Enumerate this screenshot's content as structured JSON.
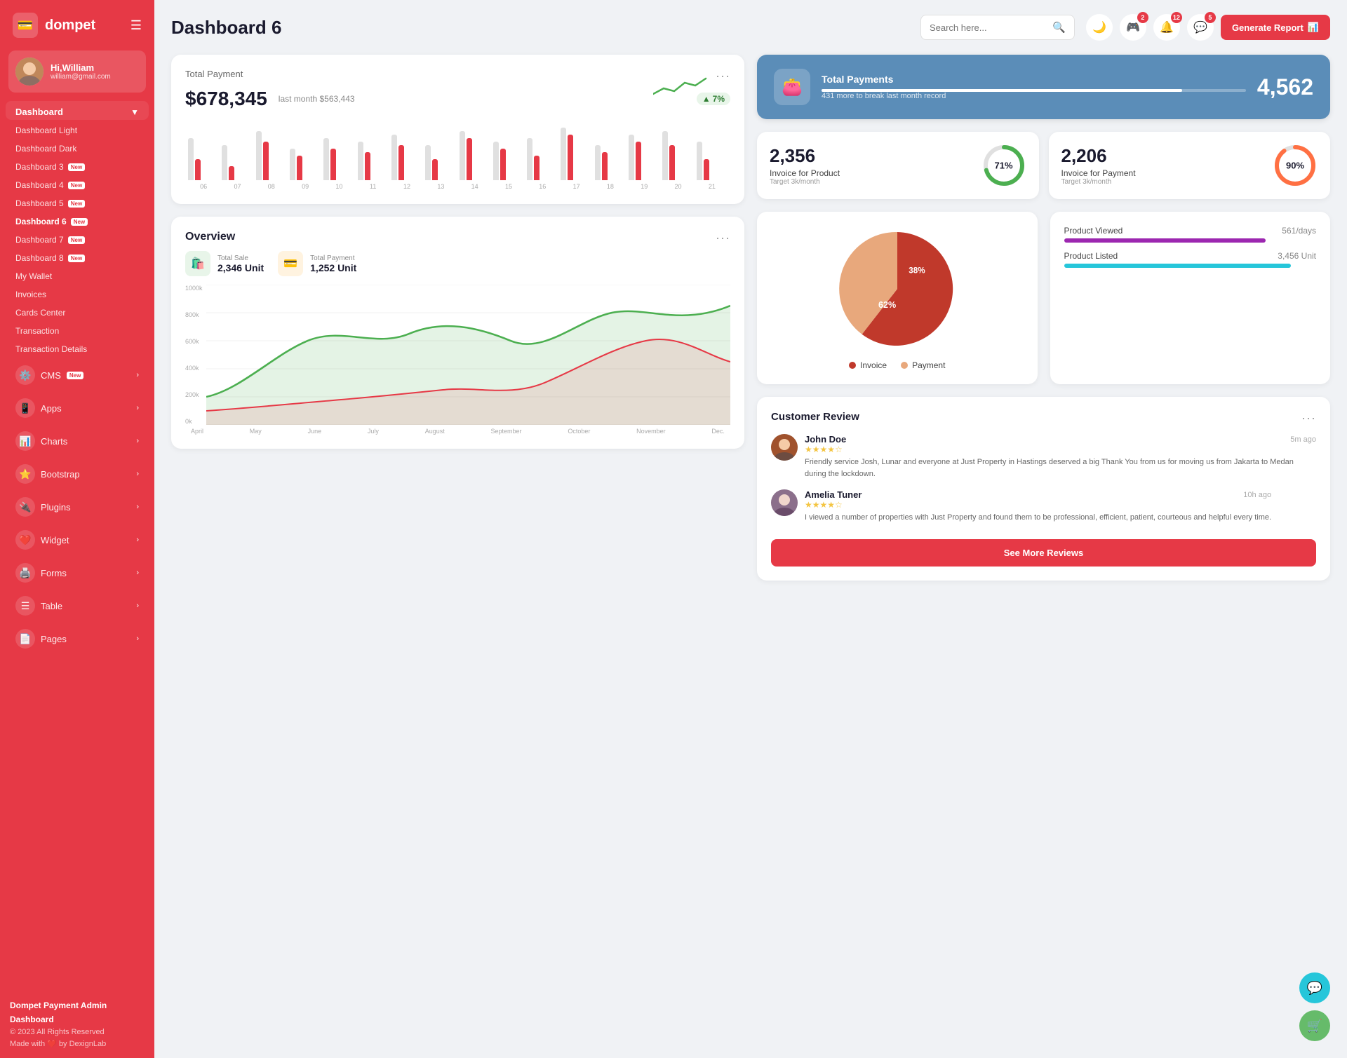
{
  "app": {
    "name": "dompet",
    "logo_icon": "💳"
  },
  "sidebar": {
    "user": {
      "greeting": "Hi,William",
      "email": "william@gmail.com"
    },
    "dashboard_section": "Dashboard",
    "dashboard_items": [
      {
        "label": "Dashboard Light",
        "new": false
      },
      {
        "label": "Dashboard Dark",
        "new": false
      },
      {
        "label": "Dashboard 3",
        "new": true
      },
      {
        "label": "Dashboard 4",
        "new": true
      },
      {
        "label": "Dashboard 5",
        "new": true
      },
      {
        "label": "Dashboard 6",
        "new": true,
        "active": true
      },
      {
        "label": "Dashboard 7",
        "new": true
      },
      {
        "label": "Dashboard 8",
        "new": true
      },
      {
        "label": "My Wallet",
        "new": false
      },
      {
        "label": "Invoices",
        "new": false
      },
      {
        "label": "Cards Center",
        "new": false
      },
      {
        "label": "Transaction",
        "new": false
      },
      {
        "label": "Transaction Details",
        "new": false
      }
    ],
    "nav_items": [
      {
        "label": "CMS",
        "icon": "⚙️",
        "new": true,
        "has_arrow": true
      },
      {
        "label": "Apps",
        "icon": "📱",
        "new": false,
        "has_arrow": true
      },
      {
        "label": "Charts",
        "icon": "📊",
        "new": false,
        "has_arrow": true
      },
      {
        "label": "Bootstrap",
        "icon": "⭐",
        "new": false,
        "has_arrow": true
      },
      {
        "label": "Plugins",
        "icon": "🔌",
        "new": false,
        "has_arrow": true
      },
      {
        "label": "Widget",
        "icon": "❤️",
        "new": false,
        "has_arrow": true
      },
      {
        "label": "Forms",
        "icon": "🖨️",
        "new": false,
        "has_arrow": true
      },
      {
        "label": "Table",
        "icon": "☰",
        "new": false,
        "has_arrow": true
      },
      {
        "label": "Pages",
        "icon": "📄",
        "new": false,
        "has_arrow": true
      }
    ],
    "footer": {
      "brand": "Dompet Payment Admin Dashboard",
      "copy": "© 2023 All Rights Reserved",
      "made_with": "Made with ❤️ by DexignLab"
    }
  },
  "header": {
    "title": "Dashboard 6",
    "search_placeholder": "Search here...",
    "notifications": [
      {
        "icon": "🎮",
        "count": 2
      },
      {
        "icon": "🔔",
        "count": 12
      },
      {
        "icon": "💬",
        "count": 5
      }
    ],
    "generate_btn": "Generate Report"
  },
  "total_payment": {
    "title": "Total Payment",
    "amount": "$678,345",
    "last_month_label": "last month $563,443",
    "badge": "7%",
    "badge_arrow": "▲",
    "bars": [
      {
        "gray": 60,
        "red": 30
      },
      {
        "gray": 50,
        "red": 20
      },
      {
        "gray": 70,
        "red": 55
      },
      {
        "gray": 45,
        "red": 35
      },
      {
        "gray": 60,
        "red": 45
      },
      {
        "gray": 55,
        "red": 40
      },
      {
        "gray": 65,
        "red": 50
      },
      {
        "gray": 50,
        "red": 30
      },
      {
        "gray": 70,
        "red": 60
      },
      {
        "gray": 55,
        "red": 45
      },
      {
        "gray": 60,
        "red": 35
      },
      {
        "gray": 75,
        "red": 65
      },
      {
        "gray": 50,
        "red": 40
      },
      {
        "gray": 65,
        "red": 55
      },
      {
        "gray": 70,
        "red": 50
      },
      {
        "gray": 55,
        "red": 30
      }
    ],
    "bar_labels": [
      "06",
      "07",
      "08",
      "09",
      "10",
      "11",
      "12",
      "13",
      "14",
      "15",
      "16",
      "17",
      "18",
      "19",
      "20",
      "21"
    ]
  },
  "total_payments_card": {
    "title": "Total Payments",
    "subtitle": "431 more to break last month record",
    "value": "4,562",
    "progress": 85
  },
  "invoice_product": {
    "value": "2,356",
    "label": "Invoice for Product",
    "sub": "Target 3k/month",
    "pct": "71%",
    "pct_num": 71,
    "color": "#4caf50"
  },
  "invoice_payment": {
    "value": "2,206",
    "label": "Invoice for Payment",
    "sub": "Target 3k/month",
    "pct": "90%",
    "pct_num": 90,
    "color": "#ff7043"
  },
  "overview": {
    "title": "Overview",
    "total_sale_label": "Total Sale",
    "total_sale_value": "2,346 Unit",
    "total_payment_label": "Total Payment",
    "total_payment_value": "1,252 Unit",
    "y_labels": [
      "1000k",
      "800k",
      "600k",
      "400k",
      "200k",
      "0k"
    ],
    "x_labels": [
      "April",
      "May",
      "June",
      "July",
      "August",
      "September",
      "October",
      "November",
      "Dec."
    ]
  },
  "pie_chart": {
    "invoice_pct": 62,
    "payment_pct": 38,
    "legend_invoice": "Invoice",
    "legend_payment": "Payment",
    "invoice_color": "#c0392b",
    "payment_color": "#e8a87c"
  },
  "product_stats": {
    "viewed_label": "Product Viewed",
    "viewed_value": "561/days",
    "viewed_color": "#9c27b0",
    "listed_label": "Product Listed",
    "listed_value": "3,456 Unit",
    "listed_color": "#26c6da"
  },
  "customer_review": {
    "title": "Customer Review",
    "reviews": [
      {
        "name": "John Doe",
        "time": "5m ago",
        "stars": 4,
        "text": "Friendly service Josh, Lunar and everyone at Just Property in Hastings deserved a big Thank You from us for moving us from Jakarta to Medan during the lockdown."
      },
      {
        "name": "Amelia Tuner",
        "time": "10h ago",
        "stars": 4,
        "text": "I viewed a number of properties with Just Property and found them to be professional, efficient, patient, courteous and helpful every time."
      }
    ],
    "see_more_btn": "See More Reviews"
  }
}
